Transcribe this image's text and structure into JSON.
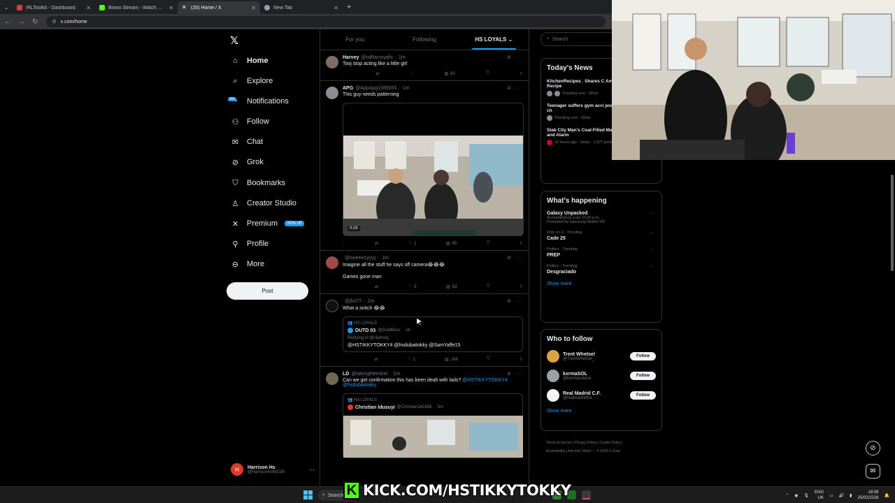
{
  "browser": {
    "tabs": [
      {
        "title": "IRLToolkit - Dashboard",
        "color": "#e53935",
        "active": false
      },
      {
        "title": "Bravo Stream - Watch Live on",
        "color": "#53fc18",
        "active": false
      },
      {
        "title": "(20) Home / X",
        "color": "#ffffff",
        "active": true
      },
      {
        "title": "New Tab",
        "color": "#9aa0a6",
        "active": false
      }
    ],
    "url": "x.com/home"
  },
  "nav": {
    "items": [
      {
        "label": "Home",
        "icon": "home-icon",
        "glyph": "⌂"
      },
      {
        "label": "Explore",
        "icon": "search-icon",
        "glyph": "⌕"
      },
      {
        "label": "Notifications",
        "icon": "bell-icon",
        "glyph": "🔔",
        "badge": "20+"
      },
      {
        "label": "Follow",
        "icon": "person-add-icon",
        "glyph": "👤"
      },
      {
        "label": "Chat",
        "icon": "mail-icon",
        "glyph": "✉"
      },
      {
        "label": "Grok",
        "icon": "grok-icon",
        "glyph": "⊘"
      },
      {
        "label": "Bookmarks",
        "icon": "bookmark-icon",
        "glyph": "🔖"
      },
      {
        "label": "Creator Studio",
        "icon": "creator-icon",
        "glyph": "♙"
      },
      {
        "label": "Premium",
        "icon": "x-icon",
        "glyph": "𝕏",
        "pill": "50% off"
      },
      {
        "label": "Profile",
        "icon": "profile-icon",
        "glyph": "👤"
      },
      {
        "label": "More",
        "icon": "more-circle-icon",
        "glyph": "⊖"
      }
    ],
    "post_label": "Post",
    "account": {
      "name": "Harrison Hs",
      "handle": "@HarrisonHs69238",
      "initial": "H"
    }
  },
  "feed": {
    "tabs": [
      "For you",
      "Following",
      "HS LOYALS"
    ],
    "tweets": [
      {
        "name": "Harvey",
        "handle": "@ridharvxyafo",
        "time": "1m",
        "text": "Tooj stop acting like a little girl",
        "views": "60",
        "likes": "",
        "replies": ""
      },
      {
        "name": "APG",
        "handle": "@AppApg1089355",
        "time": "1m",
        "text": "This guy needs patterning",
        "views": "85",
        "likes": "1",
        "video_time": "0:25"
      },
      {
        "name": "",
        "handle": "@sweeezyyyy",
        "time": "1m",
        "text": "Imagine all the stuff he says off camera😂😂😂",
        "text2": "Games gone man",
        "views": "63",
        "likes": "5"
      },
      {
        "name": "",
        "handle": "@jfot77",
        "time": "2m",
        "text": "What a snitch 😂😂",
        "views": "186",
        "likes": "1",
        "quote": {
          "community": "HS LOYALS",
          "name": "DUTD 03",
          "handle": "@DutdBoss",
          "time": "1h",
          "reply": "Replying to @clipmog",
          "text": "@HSTIKKYTOKKY4 @hsdubaitokky @SamYaffe15"
        }
      },
      {
        "name": "LD",
        "handle": "@takingthemikel",
        "time": "2m",
        "text": "Can we get confirmation this has been dealt with lads?",
        "mentions": "@HSTIKKYTOKKY4 @hsdubaitokky",
        "quote": {
          "community": "HS LOYALS",
          "name": "Christian Idusuyi",
          "handle": "@Christian181808",
          "time": "5m"
        }
      }
    ]
  },
  "right": {
    "search_placeholder": "Search",
    "news_title": "Today's News",
    "news": [
      {
        "title": "KitchenRecipes_ Shares C American Pancake Recipe",
        "meta": "Trending now · Other"
      },
      {
        "title": "Teenager suffers gym acci pound barbell drops on ch",
        "meta": "Trending now · Other"
      },
      {
        "title": "Slab City Man's Coal-Filled Mattress Sparks Awe and Alarm",
        "meta": "10 hours ago · News · 1,877 posts"
      }
    ],
    "happening_title": "What's happening",
    "trends": [
      {
        "cat": "",
        "name": "Galaxy Unpacked",
        "sub": "Acompáñanos a las 12:00 p.m.",
        "promo": "Promoted by Samsung Mobile MX"
      },
      {
        "cat": "Only on X · Trending",
        "name": "Cade 25"
      },
      {
        "cat": "Politics · Trending",
        "name": "PREP"
      },
      {
        "cat": "Politics · Trending",
        "name": "Desgraciado"
      }
    ],
    "show_more": "Show more",
    "wtf_title": "Who to follow",
    "wtf": [
      {
        "name": "Trent Whetsel",
        "handle": "@TrentWhetsel_",
        "btn": "Follow",
        "color": "#d9a441"
      },
      {
        "name": "kxrmaSOL",
        "handle": "@kxrmasolana",
        "btn": "Follow",
        "color": "#9aa0a6"
      },
      {
        "name": "Real Madrid C.F.",
        "handle": "@realmadridfra",
        "btn": "Follow",
        "color": "#f5f5f5"
      }
    ],
    "footer1": "Terms of Service  |  Privacy Policy  |  Cookie Policy  |",
    "footer2": "Accessibility  |  Ads info  |  More ···  © 2026 X Corp."
  },
  "overlay": {
    "kick_text": "KICK.COM/HSTIKKYTOKKY",
    "kick_k": "K"
  },
  "taskbar": {
    "search": "Search",
    "lang1": "ENG",
    "lang2": "UK",
    "time": "18:08",
    "date": "25/02/2026"
  }
}
